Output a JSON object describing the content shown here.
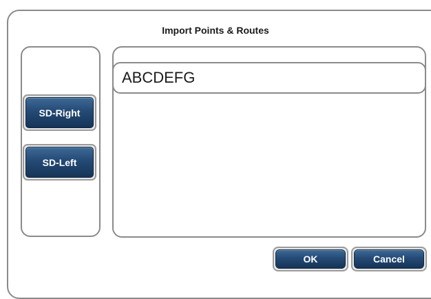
{
  "dialog": {
    "title": "Import Points & Routes"
  },
  "sources": {
    "items": [
      {
        "label": "SD-Right"
      },
      {
        "label": "SD-Left"
      }
    ]
  },
  "list": {
    "items": [
      {
        "label": "ABCDEFG"
      }
    ]
  },
  "actions": {
    "ok_label": "OK",
    "cancel_label": "Cancel"
  },
  "colors": {
    "button_face": "#244a75",
    "border": "#8a8a8a",
    "text_on_button": "#ffffff"
  }
}
